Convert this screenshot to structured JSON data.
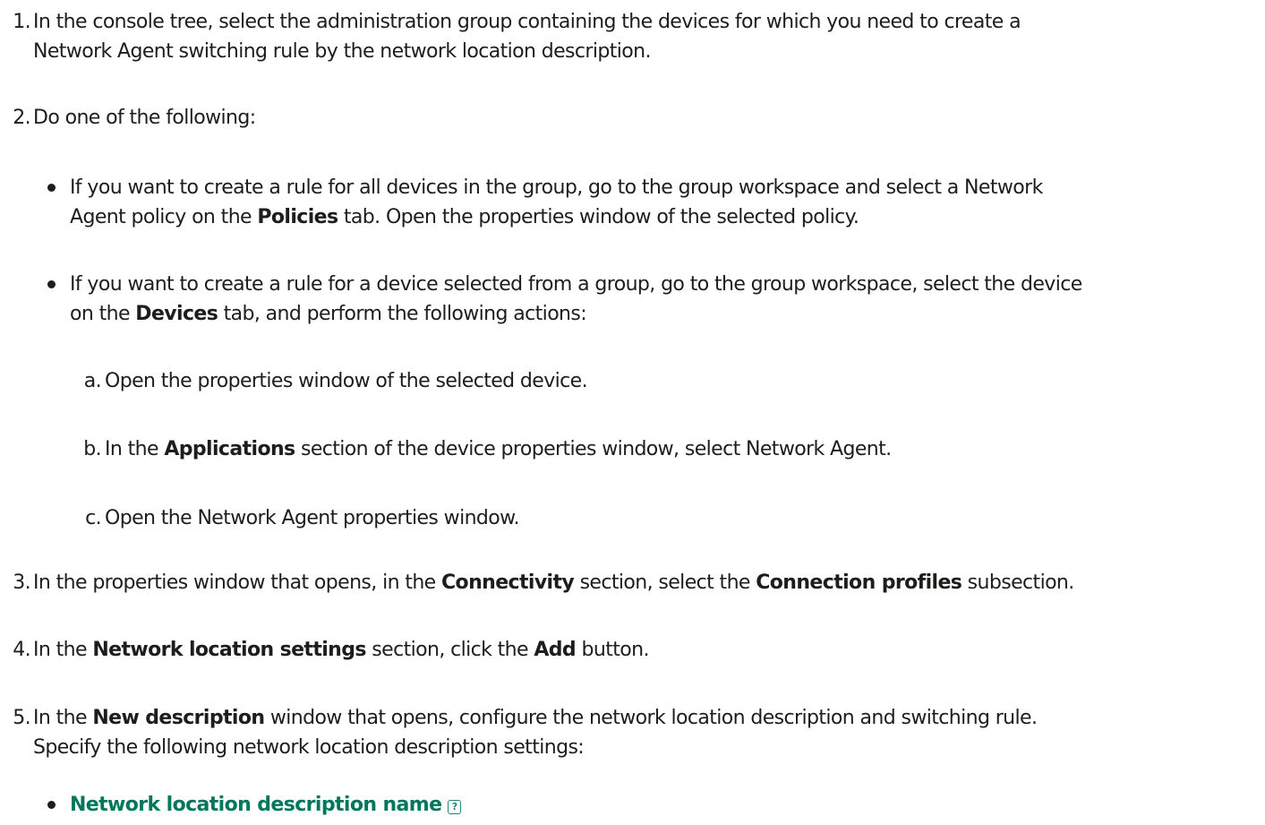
{
  "steps": {
    "s1": {
      "num": "1.",
      "line1": "In the console tree, select the administration group containing the devices for which you need to create a",
      "line2": "Network Agent switching rule by the network location description."
    },
    "s2": {
      "num": "2.",
      "text": "Do one of the following:"
    },
    "b1": {
      "line1": "If you want to create a rule for all devices in the group, go to the group workspace and select a Network",
      "l2_pre": "Agent policy on the ",
      "l2_bold": "Policies",
      "l2_post": " tab. Open the properties window of the selected policy."
    },
    "b2": {
      "line1": "If you want to create a rule for a device selected from a group, go to the group workspace, select the device",
      "l2_pre": "on the ",
      "l2_bold": "Devices",
      "l2_post": " tab, and perform the following actions:"
    },
    "sa": {
      "num": "a.",
      "text": "Open the properties window of the selected device."
    },
    "sb": {
      "num": "b.",
      "pre": "In the ",
      "bold": "Applications",
      "post": " section of the device properties window, select Network Agent."
    },
    "sc": {
      "num": "c.",
      "text": "Open the Network Agent properties window."
    },
    "s3": {
      "num": "3.",
      "pre": "In the properties window that opens, in the ",
      "bold1": "Connectivity",
      "mid": " section, select the ",
      "bold2": "Connection profiles",
      "post": " subsection."
    },
    "s4": {
      "num": "4.",
      "pre": "In the ",
      "bold1": "Network location settings",
      "mid": " section, click the ",
      "bold2": "Add",
      "post": " button."
    },
    "s5": {
      "num": "5.",
      "pre": "In the ",
      "bold": "New description",
      "post": " window that opens, configure the network location description and switching rule.",
      "line2": "Specify the following network location description settings:"
    },
    "setting": {
      "label": "Network location description name",
      "help_glyph": "?"
    }
  },
  "colors": {
    "text": "#1d1d1b",
    "link": "#00775c"
  }
}
